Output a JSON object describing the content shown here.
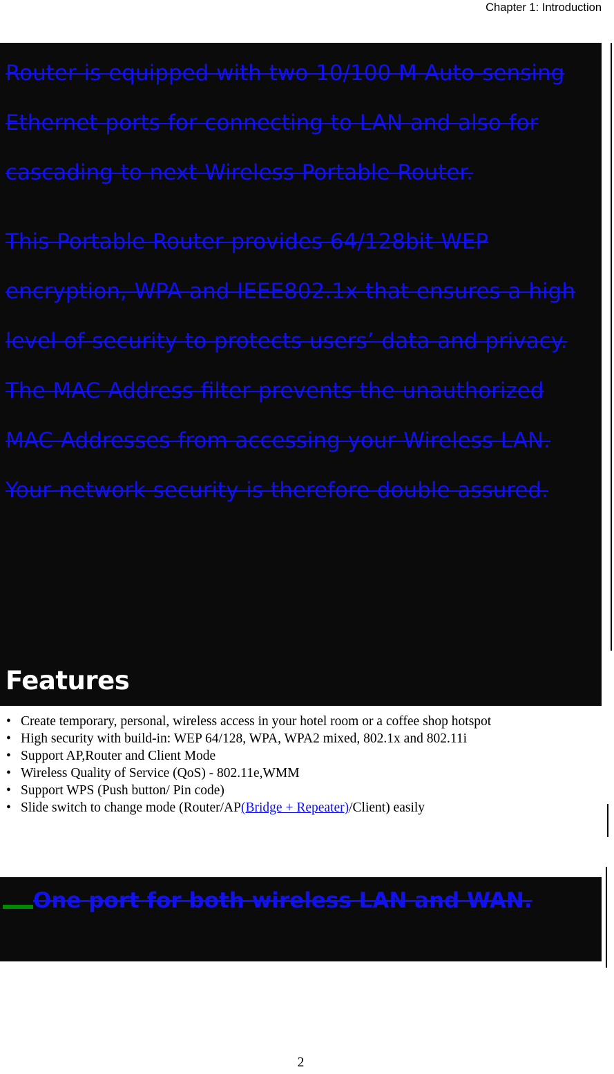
{
  "header": {
    "chapter_title": "Chapter 1: Introduction"
  },
  "deleted_blocks": {
    "paragraph_1": "Router is equipped with two 10/100 M Auto-sensing Ethernet ports for connecting to LAN and also for cascading to next Wireless Portable Router.",
    "paragraph_2": "This Portable Router provides 64/128bit WEP encryption, WPA and IEEE802.1x that ensures a high level of security to protects users’ data and privacy.  The MAC Address filter prevents the unauthorized MAC Addresses from accessing your Wireless LAN. Your network security is therefore double assured.",
    "bullet_deleted": "One port for both wireless LAN and WAN.",
    "bullet_marker": "—"
  },
  "features": {
    "heading": "Features",
    "bullet_glyph": "•",
    "items": [
      {
        "pre": "Create temporary, personal, wireless access in your hotel room or a coffee shop hotspot",
        "inserted": "",
        "post": ""
      },
      {
        "pre": "High security with build-in: WEP 64/128, WPA, WPA2 mixed, 802.1x and 802.11i",
        "inserted": "",
        "post": ""
      },
      {
        "pre": "Support AP,Router and Client Mode",
        "inserted": "",
        "post": ""
      },
      {
        "pre": "Wireless Quality of Service (QoS) - 802.11e,WMM",
        "inserted": "",
        "post": ""
      },
      {
        "pre": "Support WPS (Push button/ Pin code)",
        "inserted": "",
        "post": ""
      },
      {
        "pre": "Slide switch to change mode (Router/AP",
        "inserted": "(Bridge + Repeater)",
        "post": "/Client) easily"
      }
    ]
  },
  "footer": {
    "page_number": "2"
  },
  "colors": {
    "deletion_text": "#1111ee",
    "insertion_text": "#1111ee",
    "highlight_background": "#0b0b0b",
    "list_marker_green": "#008800",
    "change_bar": "#000000"
  }
}
